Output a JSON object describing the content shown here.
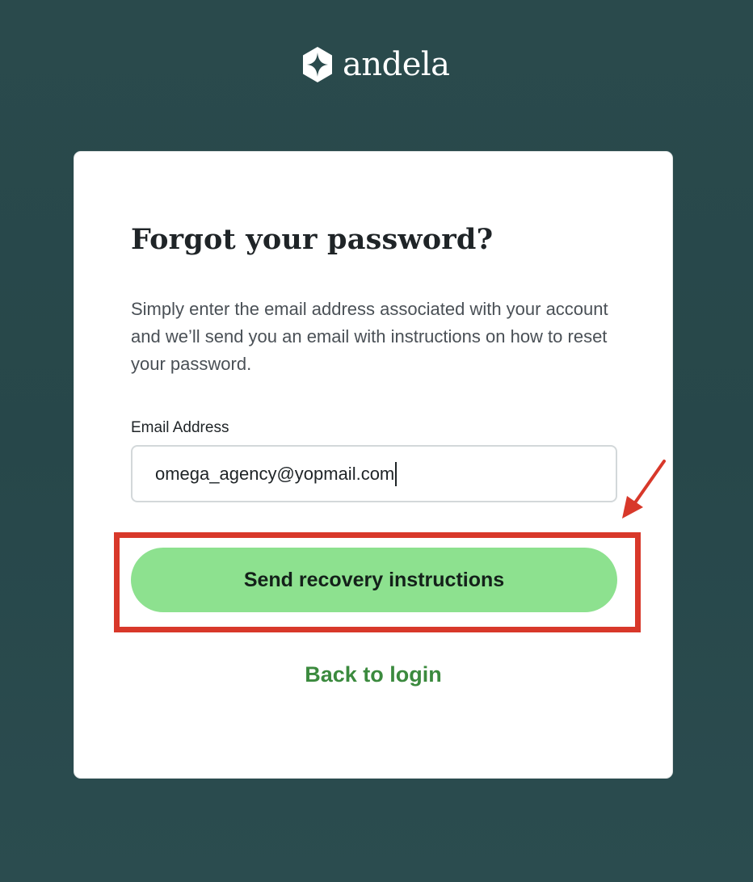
{
  "brand": {
    "name": "andela"
  },
  "form": {
    "title": "Forgot your password?",
    "description": "Simply enter the email address associated with your account and we’ll send you an email with instructions on how to reset your password.",
    "email_label": "Email Address",
    "email_value": "omega_agency@yopmail.com",
    "submit_label": "Send recovery instructions",
    "back_link": "Back to login"
  },
  "annotation": {
    "color": "#d8382a",
    "arrow_icon": "arrow-down-left-icon"
  },
  "colors": {
    "button": "#8de18f",
    "link": "#3b8a3e",
    "background": "#2a4a4c"
  }
}
